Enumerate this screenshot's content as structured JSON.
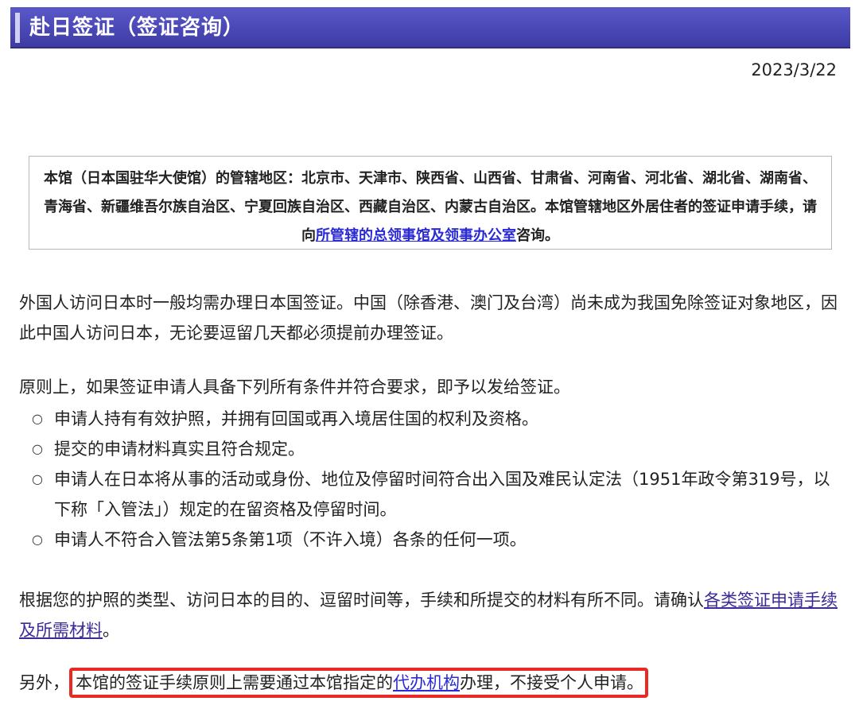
{
  "header": {
    "title": "赴日签证（签证咨询）"
  },
  "date": "2023/3/22",
  "notice": {
    "text_before_link": "本馆（日本国驻华大使馆）的管辖地区：北京市、天津市、陕西省、山西省、甘肃省、河南省、河北省、湖北省、湖南省、青海省、新疆维吾尔族自治区、宁夏回族自治区、西藏自治区、内蒙古自治区。本馆管辖地区外居住者的签证申请手续，请向",
    "link_text": "所管辖的总领事馆及领事办公室",
    "text_after_link": "咨询。"
  },
  "para1": "外国人访问日本时一般均需办理日本国签证。中国（除香港、澳门及台湾）尚未成为我国免除签证对象地区，因此中国人访问日本，无论要逗留几天都必须提前办理签证。",
  "para2": "原则上，如果签证申请人具备下列所有条件并符合要求，即予以发给签证。",
  "conditions": [
    "申请人持有有效护照，并拥有回国或再入境居住国的权利及资格。",
    "提交的申请材料真实且符合规定。",
    "申请人在日本将从事的活动或身份、地位及停留时间符合出入国及难民认定法（1951年政令第319号，以下称「入管法」）规定的在留资格及停留时间。",
    "申请人不符合入管法第5条第1项（不许入境）各条的任何一项。"
  ],
  "bullet_glyph": "○",
  "para3": {
    "text_before_link": "根据您的护照的类型、访问日本的目的、逗留时间等，手续和所提交的材料有所不同。请确认",
    "link_text": "各类签证申请手续及所需材料",
    "text_after_link": "。"
  },
  "para4": {
    "prefix": "另外，",
    "highlight_before_link": "本馆的签证手续原则上需要通过本馆指定的",
    "link_text": "代办机构",
    "highlight_after_link": "办理，不接受个人申请。"
  },
  "colors": {
    "header_bg": "#4a48b5",
    "link": "#2a2ad6",
    "highlight_border": "#e82a24"
  }
}
